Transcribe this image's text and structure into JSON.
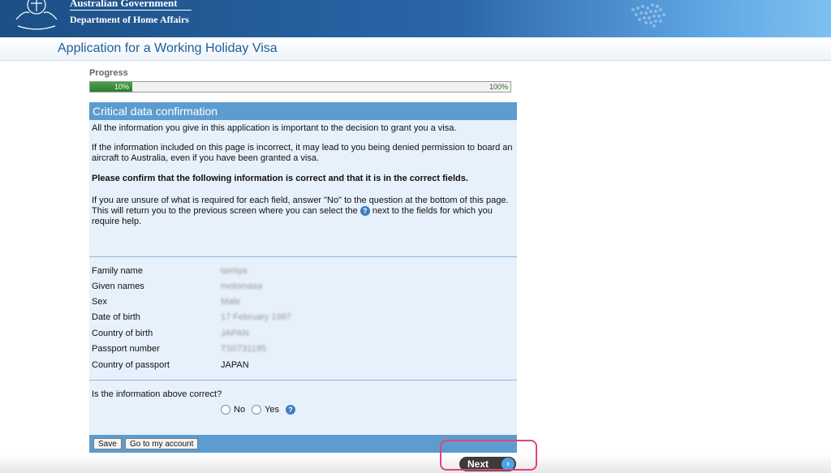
{
  "header": {
    "gov_line": "Australian Government",
    "department": "Department of Home Affairs"
  },
  "page": {
    "title": "Application for a Working Holiday Visa"
  },
  "progress": {
    "label": "Progress",
    "value_percent": 10,
    "start_label": "10%",
    "end_label": "100%"
  },
  "panel": {
    "title": "Critical data confirmation",
    "para1": "All the information you give in this application is important to the decision to grant you a visa.",
    "para2": "If the information included on this page is incorrect, it may lead to you being denied permission to board an aircraft to Australia, even if you have been granted a visa.",
    "para3": "Please confirm that the following information is correct and that it is in the correct fields.",
    "para4_a": "If you are unsure of what is required for each field, answer \"No\" to the question at the bottom of this page. This will return you to the previous screen where you can select the",
    "para4_b": "next to the fields for which you require help."
  },
  "fields": [
    {
      "label": "Family name",
      "value": "tamiya"
    },
    {
      "label": "Given names",
      "value": "motomasa"
    },
    {
      "label": "Sex",
      "value": "Male"
    },
    {
      "label": "Date of birth",
      "value": "17 February 1997"
    },
    {
      "label": "Country of birth",
      "value": "JAPAN"
    },
    {
      "label": "Passport number",
      "value": "TS0731195"
    },
    {
      "label": "Country of passport",
      "value": "JAPAN"
    }
  ],
  "question": {
    "text": "Is the information above correct?",
    "no_label": "No",
    "yes_label": "Yes"
  },
  "footer": {
    "save_label": "Save",
    "account_label": "Go to my account"
  },
  "next": {
    "label": "Next"
  },
  "icons": {
    "help": "help-icon",
    "next_arrow": "chevron-right-icon"
  },
  "colors": {
    "banner": "#2a66a8",
    "panel_head": "#5c9ccf",
    "panel_bg": "#e7f1fb",
    "highlight": "#e0457a",
    "progress": "#3f963f"
  }
}
